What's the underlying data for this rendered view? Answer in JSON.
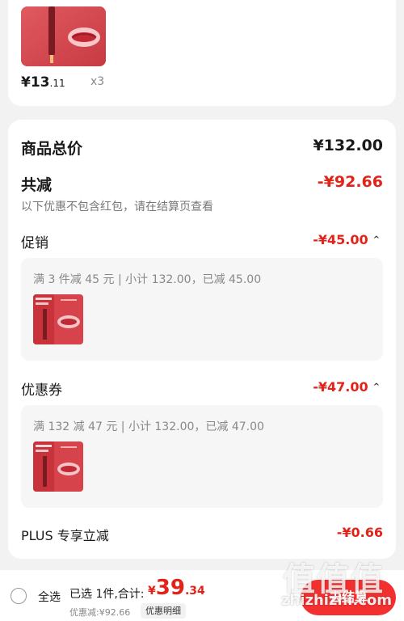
{
  "top_item": {
    "price_int": "¥13",
    "price_dec": ".11",
    "quantity": "x3"
  },
  "summary": {
    "total_label": "商品总价",
    "total_amount": "¥132.00",
    "reduce_label": "共减",
    "reduce_amount": "-¥92.66",
    "note": "以下优惠不包含红包，请在结算页查看"
  },
  "promotion": {
    "label": "促销",
    "amount": "-¥45.00",
    "rule_text": "满 3 件减 45 元 | 小计 132.00，已减 45.00"
  },
  "coupon": {
    "label": "优惠券",
    "amount": "-¥47.00",
    "rule_text": "满 132 减 47 元 | 小计 132.00，已减 47.00"
  },
  "plus": {
    "label": "PLUS 专享立减",
    "amount": "-¥0.66"
  },
  "bottom_bar": {
    "select_all": "全选",
    "selected_summary": "已选 1件,合计:",
    "total_currency": "¥",
    "total_int": "39",
    "total_dec": ".34",
    "discount_line": "优惠减:¥92.66",
    "detail_button": "优惠明细",
    "checkout_button": "去结算"
  },
  "watermark": {
    "logo": "值值值",
    "url": "zhizhizhi.com"
  },
  "colors": {
    "accent_red": "#e2231a",
    "checkout_bg": "#f23030",
    "page_bg": "#f2f2f2"
  }
}
